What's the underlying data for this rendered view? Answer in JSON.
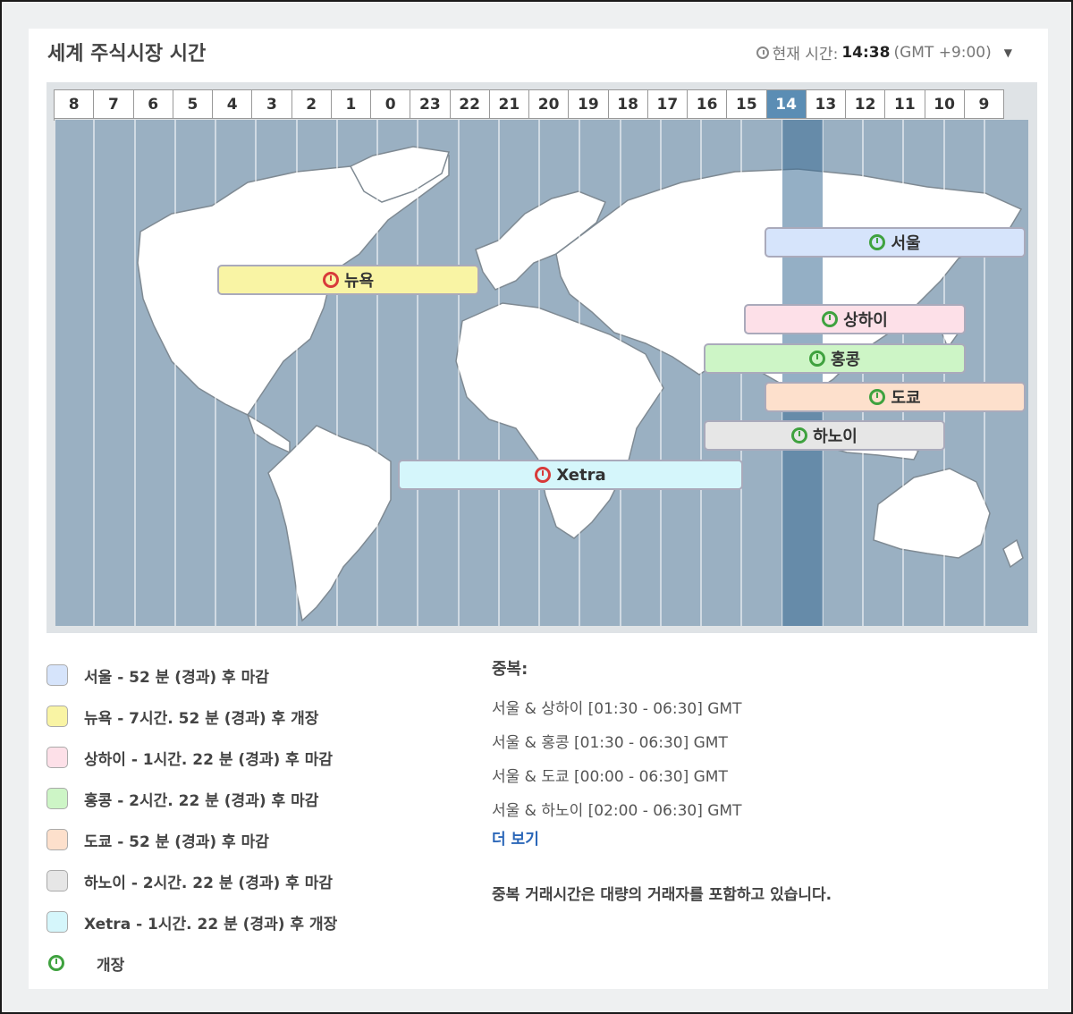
{
  "title": "세계 주식시장 시간",
  "current_time": {
    "label": "현재 시간:",
    "time": "14:38",
    "zone": "(GMT +9:00)"
  },
  "hours": [
    "8",
    "7",
    "6",
    "5",
    "4",
    "3",
    "2",
    "1",
    "0",
    "23",
    "22",
    "21",
    "20",
    "19",
    "18",
    "17",
    "16",
    "15",
    "14",
    "13",
    "12",
    "11",
    "10",
    "9"
  ],
  "current_hour": "14",
  "markets": [
    {
      "name": "서울",
      "status": "open",
      "color": "#d6e4fb"
    },
    {
      "name": "뉴욕",
      "status": "closed",
      "color": "#f9f4a4"
    },
    {
      "name": "상하이",
      "status": "open",
      "color": "#fde0e8"
    },
    {
      "name": "홍콩",
      "status": "open",
      "color": "#cdf5c6"
    },
    {
      "name": "도쿄",
      "status": "open",
      "color": "#fde0cc"
    },
    {
      "name": "하노이",
      "status": "open",
      "color": "#e6e6e6"
    },
    {
      "name": "Xetra",
      "status": "closed",
      "color": "#d5f6fb"
    }
  ],
  "legend": [
    {
      "text": "서울 - 52 분 (경과) 후 마감",
      "color": "#d6e4fb"
    },
    {
      "text": "뉴욕 - 7시간. 52 분 (경과) 후 개장",
      "color": "#f9f4a4"
    },
    {
      "text": "상하이 - 1시간. 22 분 (경과) 후 마감",
      "color": "#fde0e8"
    },
    {
      "text": "홍콩 - 2시간. 22 분 (경과) 후 마감",
      "color": "#cdf5c6"
    },
    {
      "text": "도쿄 - 52 분 (경과) 후 마감",
      "color": "#fde0cc"
    },
    {
      "text": "하노이 - 2시간. 22 분 (경과) 후 마감",
      "color": "#e6e6e6"
    },
    {
      "text": "Xetra - 1시간. 22 분 (경과) 후 개장",
      "color": "#d5f6fb"
    }
  ],
  "legend_open_label": "개장",
  "overlap": {
    "title": "중복:",
    "items": [
      "서울 & 상하이 [01:30 - 06:30] GMT",
      "서울 & 홍콩 [01:30 - 06:30] GMT",
      "서울 & 도쿄 [00:00 - 06:30] GMT",
      "서울 & 하노이 [02:00 - 06:30] GMT"
    ],
    "more": "더 보기",
    "note": "중복 거래시간은 대량의 거래자를 포함하고 있습니다."
  }
}
